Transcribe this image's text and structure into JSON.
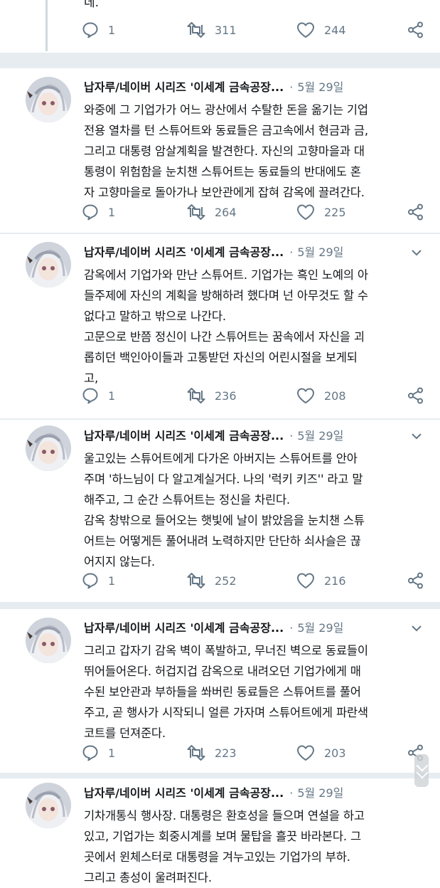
{
  "top_tweet": {
    "text": "데.",
    "reply_count": "1",
    "retweet_count": "311",
    "like_count": "244"
  },
  "tweets": [
    {
      "name": "납자루/네이버 시리즈 '이세계 금속공장...",
      "date": "5월 29일",
      "lines": [
        "와중에 그 기업가가 어느 광산에서 수탈한 돈을 옮기는 기업",
        "전용 열차를 턴 스튜어트와 동료들은 금고속에서 현금과 금,",
        "그리고 대통령 암살계획을 발견한다. 자신의 고향마을과 대",
        "통령이 위험함을 눈치챈 스튜어트는 동료들의 반대에도 혼",
        "자 고향마을로 돌아가나 보안관에게 잡혀 감옥에 끌려간다."
      ],
      "reply_count": "1",
      "retweet_count": "264",
      "like_count": "225"
    },
    {
      "name": "납자루/네이버 시리즈 '이세계 금속공장...",
      "date": "5월 29일",
      "lines": [
        "감옥에서 기업가와 만난 스튜어트. 기업가는 흑인 노예의 아",
        "들주제에 자신의 계획을 방해하려 했다며 넌 아무것도 할 수",
        "없다고 말하고 밖으로 나간다.",
        "고문으로 반쯤 정신이 나간 스튜어트는 꿈속에서 자신을 괴",
        "롭히던 백인아이들과 고통받던 자신의 어린시절을 보게되",
        "고,"
      ],
      "reply_count": "1",
      "retweet_count": "236",
      "like_count": "208"
    },
    {
      "name": "납자루/네이버 시리즈 '이세계 금속공장...",
      "date": "5월 29일",
      "lines": [
        "울고있는 스튜어트에게 다가온 아버지는 스튜어트를 안아",
        "주며 '하느님이 다 알고계실거다. 나의 '럭키 키즈'' 라고 말",
        "해주고, 그 순간 스튜어트는 정신을 차린다.",
        "감옥 창밖으로 들어오는 햇빛에 날이 밝았음을 눈치챈 스튜",
        "어트는 어떻게든 풀어내려 노력하지만 단단하 쇠사슬은 끊",
        "어지지 않는다."
      ],
      "reply_count": "1",
      "retweet_count": "252",
      "like_count": "216"
    },
    {
      "name": "납자루/네이버 시리즈 '이세계 금속공장...",
      "date": "5월 29일",
      "lines": [
        "그리고 갑자기 감옥 벽이 폭발하고, 무너진 벽으로 동료들이",
        "뛰어들어온다. 허겁지겁 감옥으로 내려오던 기업가에게 매",
        "수된 보안관과 부하들을 쏴버린 동료들은 스튜어트를 풀어",
        "주고, 곧 행사가 시작되니 얼른 가자며 스튜어트에게 파란색",
        "코트를 던져준다."
      ],
      "reply_count": "1",
      "retweet_count": "223",
      "like_count": "203"
    },
    {
      "name": "납자루/네이버 시리즈 '이세계 금속공장...",
      "date": "5월 29일",
      "lines": [
        "기차개통식 행사장. 대통령은 환호성을 들으며 연설을 하고",
        "있고, 기업가는 회중시계를 보며 물탑을 흘끗 바라본다. 그",
        "곳에서 윈체스터로 대통령을 겨누고있는 기업가의 부하.",
        "그리고 총성이 울려퍼진다."
      ]
    }
  ],
  "icons": {
    "reply": "speech-bubble-icon",
    "retweet": "retweet-arrows-icon",
    "like": "heart-icon",
    "share": "share-icon",
    "menu": "chevron-down-icon"
  },
  "colors": {
    "text": "#14171a",
    "muted": "#657786",
    "separator": "#e6ecf0"
  }
}
